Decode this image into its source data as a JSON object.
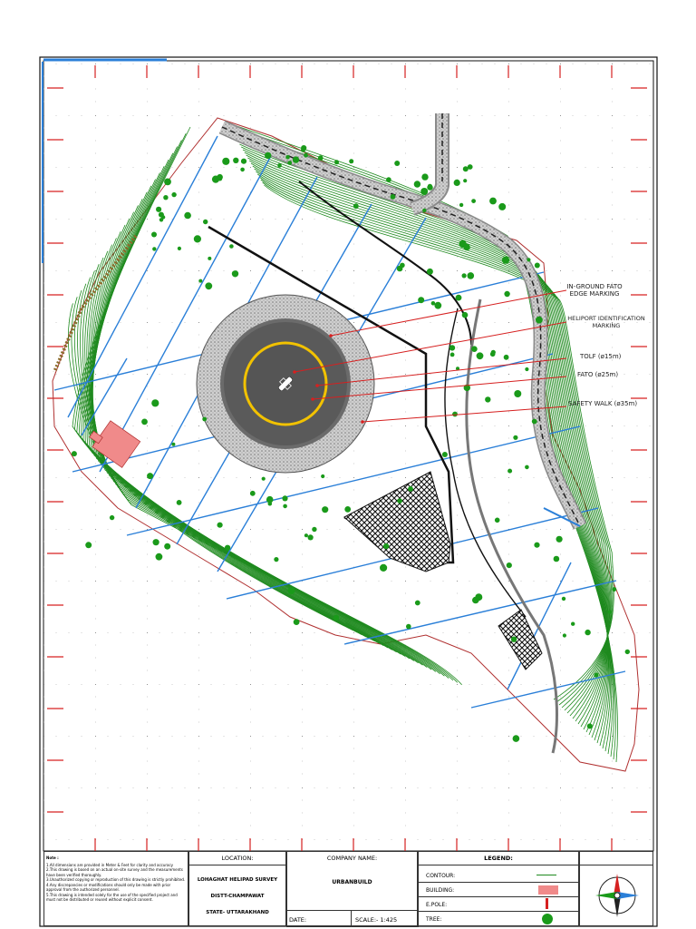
{
  "callouts": {
    "fato_edge": [
      "IN-GROUND FATO",
      "EDGE MARKING"
    ],
    "heliport_id": [
      "HELIPORT IDENTIFICATION",
      "MARKING"
    ],
    "tolf": "TOLF (ø15m)",
    "fato": "FATO (ø25m)",
    "safety_walk": "SAFETY WALK (ø35m)"
  },
  "title_block": {
    "notes_header": "Note :",
    "notes": [
      "1.All dimensions are provided in Meter & Feet for clarity and accuracy",
      "2.This drawing is based on an actual on-site survey and the measurements have been verified thoroughly.",
      "3.Unauthorized copying or reproduction of this drawing is strictly prohibited.",
      "4.Any discrepancies or modifications should only be made with prior approval from the authorized personnel.",
      "5.This drawing is intended solely for the use of the specified project and must not be distributed or reused without explicit consent."
    ],
    "location_header": "LOCATION:",
    "location_lines": [
      "LOHAGHAT HELIPAD SURVEY",
      "DISTT-CHAMPAWAT",
      "STATE- UTTARAKHAND"
    ],
    "company_header": "COMPANY NAME:",
    "company_name": "URBANBUILD",
    "date_label": "DATE:",
    "scale_label": "SCALE:- 1:425",
    "legend_header": "LEGEND:",
    "legend_items": [
      "CONTOUR:",
      "BUILDING:",
      "E.POLE:",
      "TREE:"
    ]
  },
  "colors": {
    "contour": "#1f8a1f",
    "grid_blue": "#2a7fd8",
    "callout_red": "#d62020",
    "building": "#f08a8a",
    "tree": "#1a9a1a",
    "tlof_ring": "#f2c200"
  }
}
